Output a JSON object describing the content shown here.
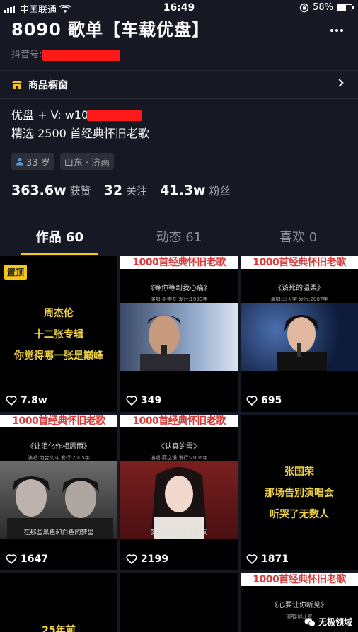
{
  "status_bar": {
    "carrier": "中国联通",
    "time": "16:49",
    "battery": "58%",
    "battery_level": 0.58
  },
  "profile": {
    "title": "8090 歌单【车载优盘】",
    "douyin_id_prefix": "抖音号:",
    "shop_label": "商品橱窗",
    "bio_line1": "优盘 + V: w10",
    "bio_line2": "精选 2500 首经典怀旧老歌",
    "tags": [
      {
        "icon": "person-icon",
        "label": "33 岁"
      },
      {
        "label": "山东 · 济南"
      }
    ],
    "stats": [
      {
        "value": "363.6w",
        "label": "获赞"
      },
      {
        "value": "32",
        "label": "关注"
      },
      {
        "value": "41.3w",
        "label": "粉丝"
      }
    ]
  },
  "tabs": [
    {
      "label": "作品 60",
      "active": true
    },
    {
      "label": "动态 61",
      "active": false
    },
    {
      "label": "喜欢 0",
      "active": false
    }
  ],
  "banner_text": "1000首经典怀旧老歌",
  "videos": [
    {
      "pin": "置顶",
      "lines": [
        "周杰伦",
        "十二张专辑",
        "你觉得哪一张是巅峰"
      ],
      "likes": "7.8w"
    },
    {
      "song": "《等你等到我心痛》",
      "credits": "演唱:张学友    发行:1993年",
      "likes": "349"
    },
    {
      "song": "《该死的温柔》",
      "credits": "演唱:马天宇    发行:2007年",
      "likes": "695"
    },
    {
      "song": "《让泪化作相思雨》",
      "credits": "演唱:南合文斗    发行:2005年",
      "caption": "在那些黑色和白色的梦里",
      "likes": "1647"
    },
    {
      "song": "《认真的雪》",
      "credits": "演唱:薛之谦    发行:2006年",
      "caption": "就在你说分手的瞬间",
      "likes": "2199"
    },
    {
      "lines": [
        "张国荣",
        "那场告别演唱会",
        "听哭了无数人"
      ],
      "likes": "1871"
    },
    {
      "partial_text": "25年前"
    },
    {},
    {
      "song": "《心要让你听见》",
      "credits": "演唱:邱正宣",
      "watermark": "无极领域"
    }
  ],
  "colors": {
    "background": "#161823",
    "accent": "#facc15",
    "redact": "#ff1a1a"
  }
}
